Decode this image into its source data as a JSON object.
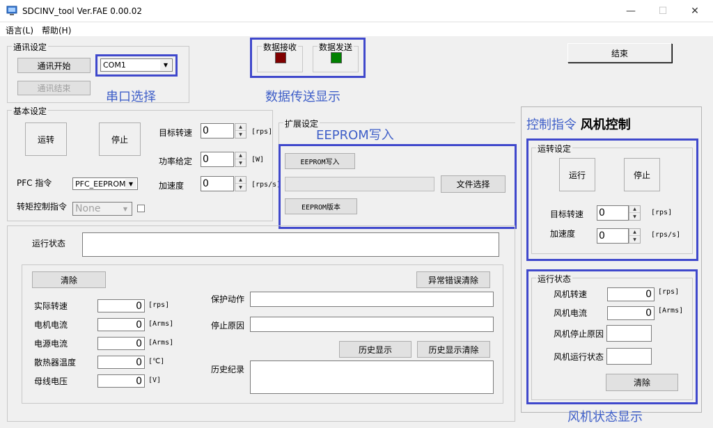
{
  "window": {
    "title": "SDCINV_tool Ver.FAE 0.00.02",
    "min": "—",
    "max": "☐",
    "close": "✕"
  },
  "menu": {
    "language": "语言(L)",
    "help": "帮助(H)"
  },
  "comm": {
    "group": "通讯设定",
    "start": "通讯开始",
    "end": "通讯结束",
    "port": "COM1"
  },
  "indicators": {
    "recv": "数据接收",
    "send": "数据发送",
    "recv_color": "#800000",
    "send_color": "#008000"
  },
  "finish_button": "结束",
  "basic": {
    "group": "基本设定",
    "run": "运转",
    "stop": "停止",
    "target_speed_label": "目标转速",
    "target_speed": "0",
    "target_speed_unit": "[rps]",
    "power_label": "功率给定",
    "power": "0",
    "power_unit": "[W]",
    "accel_label": "加速度",
    "accel": "0",
    "accel_unit": "[rps/s]",
    "pfc_label": "PFC 指令",
    "pfc_value": "PFC_EEPROM",
    "torque_label": "转矩控制指令",
    "torque_value": "None"
  },
  "ext": {
    "group": "扩展设定",
    "eeprom_write": "EEPROM写入",
    "file_select": "文件选择",
    "eeprom_version": "EEPROM版本"
  },
  "status": {
    "run_state_label": "运行状态",
    "clear": "清除",
    "error_clear": "异常错误清除",
    "rows": [
      {
        "label": "实际转速",
        "value": "0",
        "unit": "[rps]"
      },
      {
        "label": "电机电流",
        "value": "0",
        "unit": "[Arms]"
      },
      {
        "label": "电源电流",
        "value": "0",
        "unit": "[Arms]"
      },
      {
        "label": "散热器温度",
        "value": "0",
        "unit": "[℃]"
      },
      {
        "label": "母线电压",
        "value": "0",
        "unit": "[V]"
      }
    ],
    "protect_label": "保护动作",
    "stop_reason_label": "停止原因",
    "history_show": "历史显示",
    "history_clear": "历史显示清除",
    "history_label": "历史纪录"
  },
  "right": {
    "header_blue": "控制指令",
    "header_black": "风机控制",
    "run_group": "运转设定",
    "run": "运行",
    "stop": "停止",
    "target_speed_label": "目标转速",
    "target_speed": "0",
    "target_speed_unit": "[rps]",
    "accel_label": "加速度",
    "accel": "0",
    "accel_unit": "[rps/s]",
    "state_group": "运行状态",
    "fan_speed_label": "风机转速",
    "fan_speed": "0",
    "fan_speed_unit": "[rps]",
    "fan_current_label": "风机电流",
    "fan_current": "0",
    "fan_current_unit": "[Arms]",
    "fan_stop_reason_label": "风机停止原因",
    "fan_run_state_label": "风机运行状态",
    "clear": "清除"
  },
  "annotations": {
    "serial": "串口选择",
    "data_transfer": "数据传送显示",
    "eeprom_write": "EEPROM写入",
    "fan_status": "风机状态显示"
  }
}
